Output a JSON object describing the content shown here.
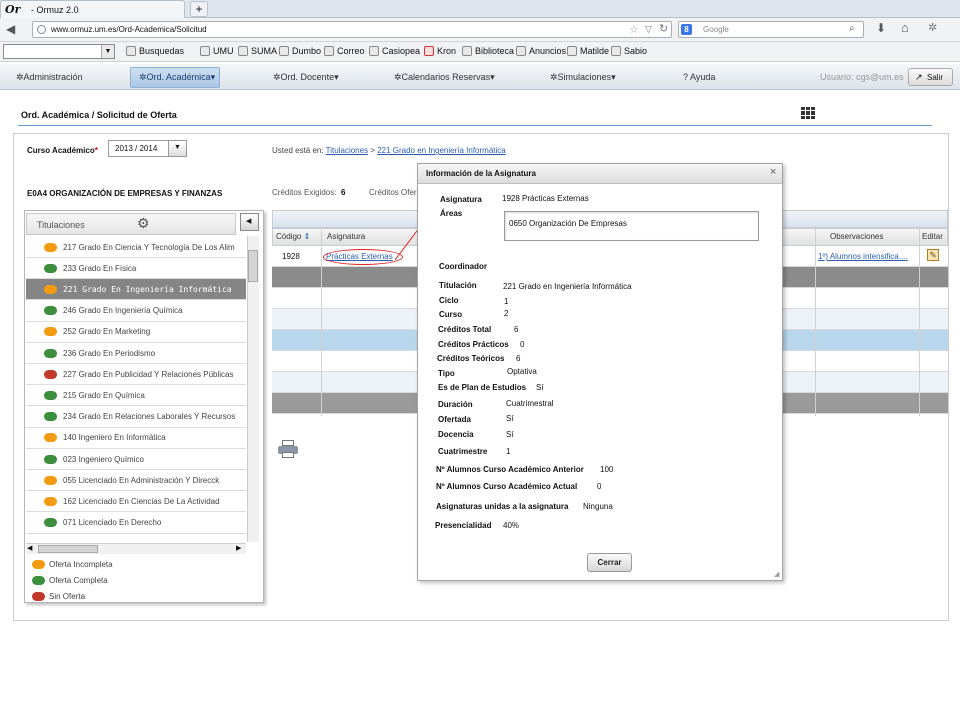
{
  "browser": {
    "tab_title": "- Ormuz 2.0",
    "logo": "Or",
    "new_tab": "+",
    "url": "www.ormuz.um.es/Ord-Academica/Solicitud",
    "search_placeholder": "Google",
    "bookmarks": [
      "Busquedas",
      "UMU",
      "SUMA",
      "Dumbo",
      "Correo",
      "Casiopea",
      "Kron",
      "Biblioteca",
      "Anuncios",
      "Matilde",
      "Sabio"
    ]
  },
  "menu": {
    "items": [
      "Administración",
      "Ord. Académica",
      "Ord. Docente",
      "Calendarios Reservas",
      "Simulaciones",
      "Ayuda"
    ],
    "user": "Usuario: cgs@um.es",
    "salir": "Salir"
  },
  "page": {
    "title": "Ord. Académica / Solicitud de Oferta",
    "curso_label": "Curso Académico",
    "required_mark": "*",
    "curso_value": "2013 / 2014",
    "breadcrumb_prefix": "Usted está en:",
    "breadcrumb_1": "Titulaciones",
    "breadcrumb_sep": ">",
    "breadcrumb_2": "221  Grado en Ingeniería Informática",
    "area_title": "E0A4  ORGANIZACIÓN DE EMPRESAS Y FINANZAS",
    "creditos_exigidos_label": "Créditos Exigidos:",
    "creditos_exigidos_value": "6",
    "creditos_ofertados_label": "Créditos Ofer"
  },
  "titulaciones": {
    "header": "Titulaciones",
    "items": [
      {
        "label": "217  Grado En Ciencia Y Tecnología De Los Alim",
        "status": "orange"
      },
      {
        "label": "233  Grado En Física",
        "status": "green"
      },
      {
        "label": "221  Grado En Ingeniería Informática",
        "status": "orange",
        "selected": true
      },
      {
        "label": "246  Grado En Ingeniería Química",
        "status": "green"
      },
      {
        "label": "252  Grado En Marketing",
        "status": "orange"
      },
      {
        "label": "236  Grado En Periodismo",
        "status": "green"
      },
      {
        "label": "227  Grado En Publicidad Y Relaciones Públicas",
        "status": "red"
      },
      {
        "label": "215  Grado En Química",
        "status": "green"
      },
      {
        "label": "234  Grado En Relaciones Laborales Y Recursos",
        "status": "green"
      },
      {
        "label": "140  Ingeniero En Informática",
        "status": "orange"
      },
      {
        "label": "023  Ingeniero Químico",
        "status": "green"
      },
      {
        "label": "055  Licenciado En Administración Y Direcck",
        "status": "orange"
      },
      {
        "label": "162  Licenciado En Ciencias De La Actividad",
        "status": "orange"
      },
      {
        "label": "071  Licenciado En Derecho",
        "status": "green"
      }
    ],
    "legend": [
      {
        "label": "Oferta Incompleta",
        "status": "orange"
      },
      {
        "label": "Oferta Completa",
        "status": "green"
      },
      {
        "label": "Sin Oferta",
        "status": "red"
      }
    ]
  },
  "colors": {
    "orange": "#f39c12",
    "green": "#3c8f3c",
    "red": "#c0392b",
    "accent": "#2a5db0"
  },
  "table": {
    "headers": {
      "codigo": "Código",
      "asignatura": "Asignatura",
      "observaciones": "Observaciones",
      "editar": "Editar"
    },
    "row": {
      "codigo": "1928",
      "asignatura": "Prácticas Externas",
      "observaciones": "1º) Alumnos intensifica...."
    }
  },
  "dialog": {
    "title": "Información de la Asignatura",
    "close": "×",
    "fields": {
      "asignatura_label": "Asignatura",
      "asignatura": "1928  Prácticas Externas",
      "areas_label": "Áreas",
      "areas": "0650  Organización De Empresas",
      "coordinador_label": "Coordinador",
      "titulacion_label": "Titulación",
      "titulacion": "221  Grado en Ingeniería Informática",
      "ciclo_label": "Ciclo",
      "ciclo": "1",
      "curso_label": "Curso",
      "curso": "2",
      "ctotal_label": "Créditos Total",
      "ctotal": "6",
      "cprac_label": "Créditos Prácticos",
      "cprac": "0",
      "cteor_label": "Créditos Teóricos",
      "cteor": "6",
      "tipo_label": "Tipo",
      "tipo": "Optativa",
      "plan_label": "Es de Plan de Estudios",
      "plan": "Sí",
      "duracion_label": "Duración",
      "duracion": "Cuatrimestral",
      "ofertada_label": "Ofertada",
      "ofertada": "Sí",
      "docencia_label": "Docencia",
      "docencia": "Sí",
      "cuatrimestre_label": "Cuatrimestre",
      "cuatrimestre": "1",
      "alumnos_ant_label": "Nº Alumnos Curso Académico Anterior",
      "alumnos_ant": "100",
      "alumnos_act_label": "Nº Alumnos Curso Académico Actual",
      "alumnos_act": "0",
      "unidas_label": "Asignaturas unidas a la asignatura",
      "unidas": "Ninguna",
      "presencialidad_label": "Presencialidad",
      "presencialidad": "40%"
    },
    "cerrar": "Cerrar"
  }
}
